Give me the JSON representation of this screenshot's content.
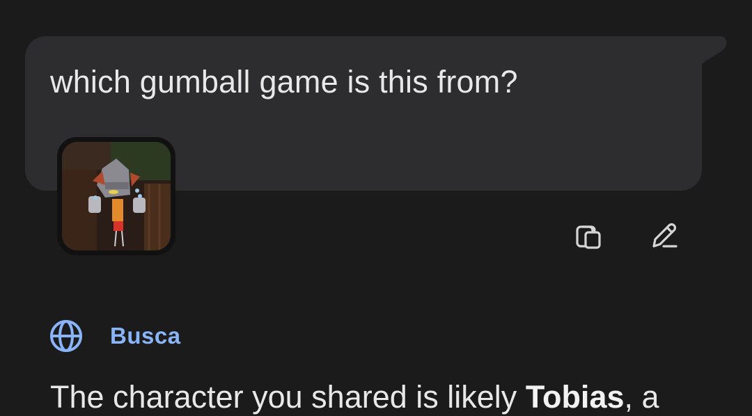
{
  "user_message": {
    "text": "which gumball game is this from?",
    "attachment_icon": "image-thumbnail"
  },
  "message_actions": {
    "copy_icon": "copy-icon",
    "edit_icon": "edit-pencil-icon"
  },
  "response": {
    "source_icon": "globe-icon",
    "source_label": "Busca",
    "text_before": "The character you shared is likely ",
    "text_bold": "Tobias",
    "text_after": ", a"
  },
  "colors": {
    "background": "#1b1b1c",
    "bubble": "#2d2d2f",
    "accent": "#8ab4f8",
    "text": "#e8e8e8"
  }
}
